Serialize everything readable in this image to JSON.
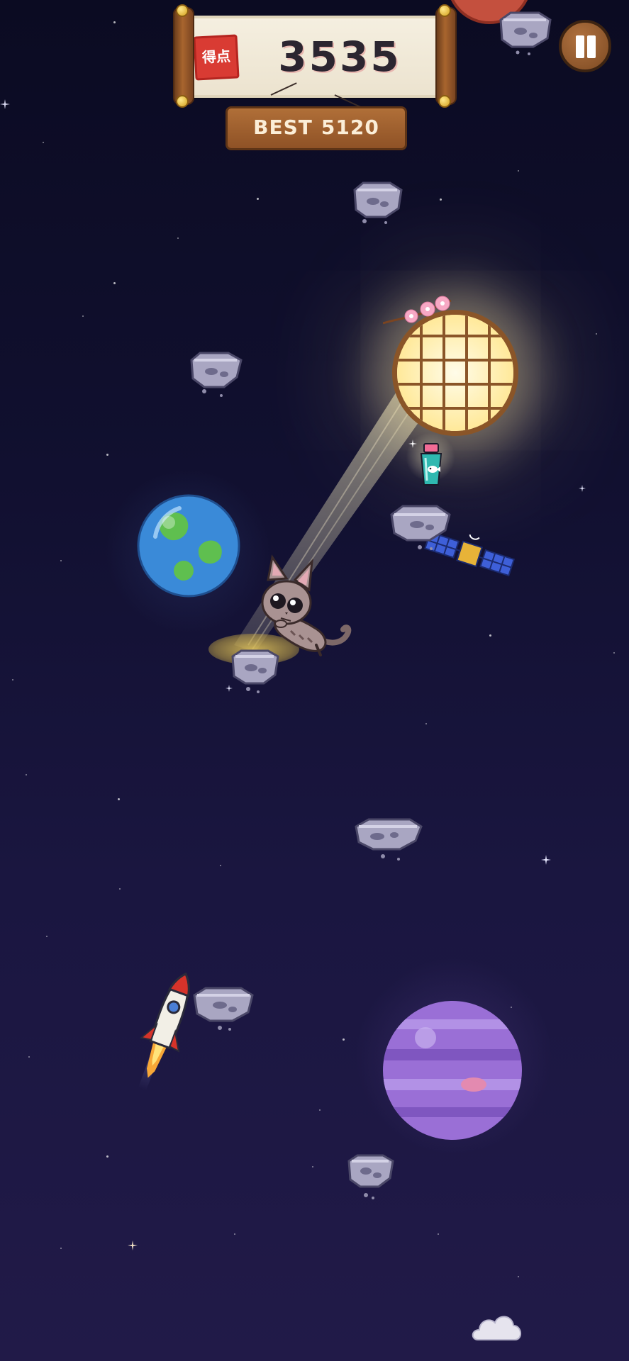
{
  "hud": {
    "score_stamp": "得点",
    "score": "3535",
    "best_label": "BEST",
    "best_value": "5120"
  },
  "colors": {
    "background_top": "#0b0b22",
    "background_bottom": "#211a48",
    "wood": "#8f5226",
    "stamp_red": "#d93b33",
    "earth_blue": "#3a8ad8",
    "earth_green": "#5fbf4f",
    "jupiter_purple": "#9a6fd6",
    "mars_red": "#c4503e"
  },
  "icons": {
    "pause": "pause-icon",
    "player": "cat-icon",
    "lantern": "lantern-icon",
    "powerup": "fish-can-icon",
    "satellite": "satellite-icon",
    "rocket": "rocket-icon",
    "cloud": "cloud-icon"
  }
}
